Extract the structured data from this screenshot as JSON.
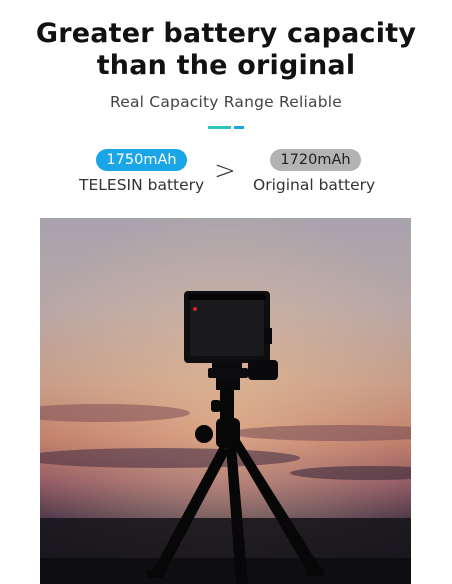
{
  "headline": {
    "line1": "Greater battery capacity",
    "line2": "than the original"
  },
  "subheading": "Real Capacity Range Reliable",
  "comparison": {
    "telesin": {
      "capacity": "1750mAh",
      "label": "TELESIN battery"
    },
    "sign": ">",
    "original": {
      "capacity": "1720mAh",
      "label": "Original battery"
    }
  },
  "colors": {
    "accent_blue": "#1aa5e6",
    "accent_teal": "#2ec4b6",
    "pill_gray": "#b3b3b3",
    "headline": "#111111"
  },
  "photo": {
    "subject": "action camera on mini tripod silhouette at sunset"
  }
}
